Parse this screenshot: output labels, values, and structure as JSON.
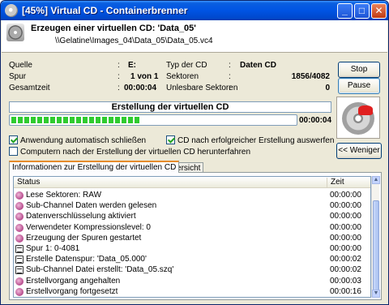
{
  "window": {
    "title": "[45%] Virtual CD - Containerbrenner"
  },
  "header": {
    "title": "Erzeugen einer virtuellen CD: 'Data_05'",
    "path": "\\\\Gelatine\\Images_04\\Data_05\\Data_05.vc4"
  },
  "info": {
    "quelle_label": "Quelle",
    "quelle_value": "E:",
    "spur_label": "Spur",
    "spur_value": "1 von 1",
    "gesamtzeit_label": "Gesamtzeit",
    "gesamtzeit_value": "00:00:04",
    "typ_label": "Typ der CD",
    "typ_value": "Daten CD",
    "sektoren_label": "Sektoren",
    "sektoren_value": "1856/4082",
    "unlesbare_label": "Unlesbare Sektoren",
    "unlesbare_value": "0",
    "colon": ":"
  },
  "buttons": {
    "stop": "Stop",
    "pause": "Pause",
    "weniger": "<< Weniger"
  },
  "progress": {
    "status_text": "Erstellung der virtuellen CD",
    "percent": 0.45,
    "time": "00:00:04"
  },
  "options": {
    "auto_close": {
      "label": "Anwendung automatisch schließen",
      "checked": true
    },
    "eject": {
      "label": "CD nach erfolgreicher Erstellung auswerfen",
      "checked": true
    },
    "shutdown": {
      "label": "Computern nach der Erstellung der virtuellen CD herunterfahren",
      "checked": false
    }
  },
  "tabs": [
    {
      "label": "Informationen zur Erstellung der virtuellen CD",
      "active": true
    },
    {
      "label": "CD Übersicht",
      "active": false
    }
  ],
  "log": {
    "col_status": "Status",
    "col_zeit": "Zeit",
    "rows": [
      {
        "text": "Lese Sektoren: RAW",
        "time": "00:00:00",
        "icon": "info-icon"
      },
      {
        "text": "Sub-Channel Daten werden gelesen",
        "time": "00:00:00",
        "icon": "info-icon"
      },
      {
        "text": "Datenverschlüsselung aktiviert",
        "time": "00:00:00",
        "icon": "info-icon"
      },
      {
        "text": "Verwendeter Kompressionslevel: 0",
        "time": "00:00:00",
        "icon": "info-icon"
      },
      {
        "text": "Erzeugung der Spuren gestartet",
        "time": "00:00:00",
        "icon": "info-icon"
      },
      {
        "text": "Spur 1: 0-4081",
        "time": "00:00:00",
        "icon": "document-icon"
      },
      {
        "text": "Erstelle Datenspur: 'Data_05.000'",
        "time": "00:00:02",
        "icon": "document-icon"
      },
      {
        "text": "Sub-Channel Datei erstellt: 'Data_05.szq'",
        "time": "00:00:02",
        "icon": "document-icon"
      },
      {
        "text": "Erstellvorgang angehalten",
        "time": "00:00:03",
        "icon": "info-icon"
      },
      {
        "text": "Erstellvorgang fortgesetzt",
        "time": "00:00:16",
        "icon": "info-icon"
      }
    ]
  }
}
